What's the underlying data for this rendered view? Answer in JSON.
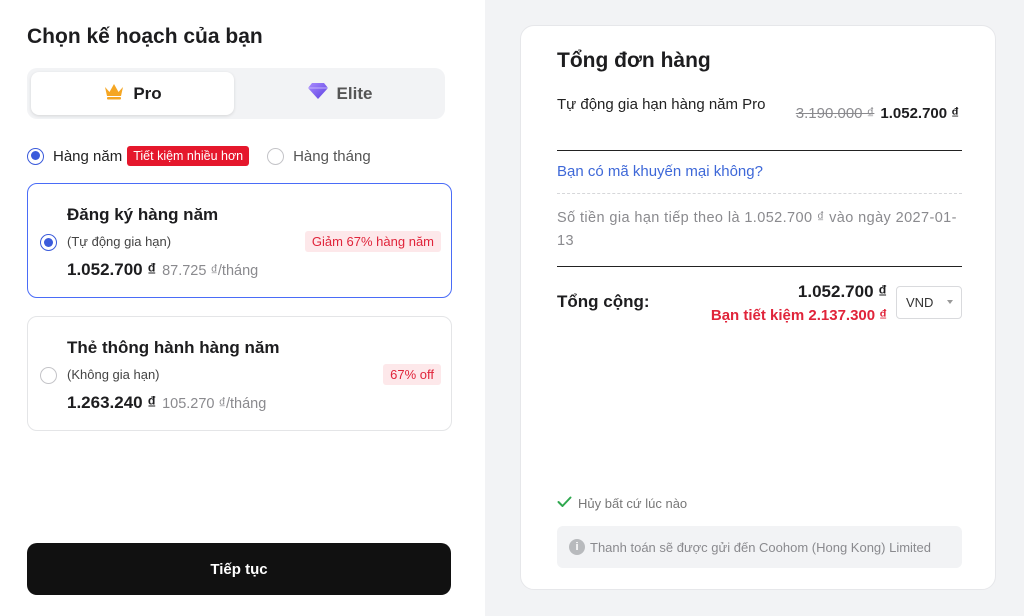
{
  "left": {
    "heading": "Chọn kế hoạch của bạn",
    "plan_tabs": [
      {
        "label": "Pro",
        "icon": "crown-icon",
        "selected": true
      },
      {
        "label": "Elite",
        "icon": "diamond-icon",
        "selected": false
      }
    ],
    "billing": {
      "annual_label": "Hàng năm",
      "annual_badge": "Tiết kiệm nhiều hơn",
      "monthly_label": "Hàng tháng",
      "selected": "annual"
    },
    "cards": [
      {
        "title": "Đăng ký hàng năm",
        "subtitle": "(Tự động gia hạn)",
        "badge": "Giảm 67% hàng năm",
        "price": "1.052.700 ₫",
        "per_month": "87.725 ₫/tháng",
        "selected": true
      },
      {
        "title": "Thẻ thông hành hàng năm",
        "subtitle": "(Không gia hạn)",
        "badge": "67% off",
        "price": "1.263.240 ₫",
        "per_month": "105.270 ₫/tháng",
        "selected": false
      }
    ],
    "continue_label": "Tiếp tục"
  },
  "summary": {
    "title": "Tổng đơn hàng",
    "item_desc": "Tự động gia hạn hàng năm Pro",
    "old_price": "3.190.000 ₫",
    "new_price": "1.052.700 ₫",
    "promo_link": "Bạn có mã khuyến mại không?",
    "renewal_note": "Số tiền gia hạn tiếp theo là 1.052.700 ₫ vào ngày 2027-01-13",
    "total_label": "Tổng cộng:",
    "total_amount": "1.052.700 ₫",
    "saving": "Bạn tiết kiệm 2.137.300 ₫",
    "currency": "VND",
    "cancel_note": "Hủy bất cứ lúc nào",
    "payment_note": "Thanh toán sẽ được gửi đến Coohom (Hong Kong) Limited"
  },
  "colors": {
    "accent_blue": "#3b5bdb",
    "danger_red": "#e5172c",
    "button_black": "#111111",
    "crown_orange": "#f5a623",
    "diamond_purple": "#7b5cf0"
  }
}
